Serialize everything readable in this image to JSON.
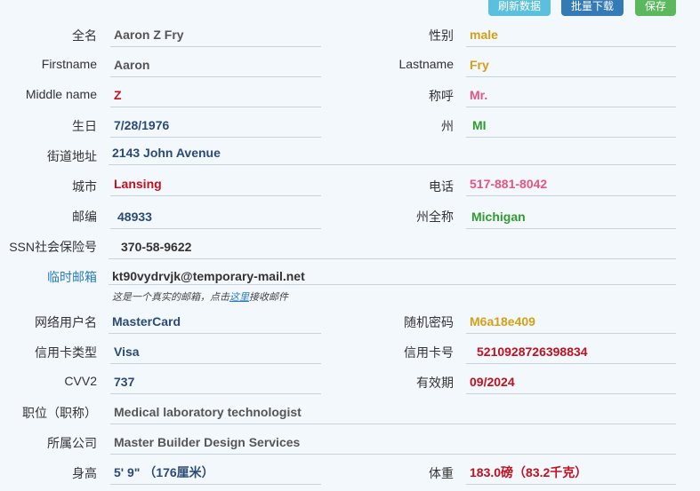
{
  "toolbar": {
    "refresh_label": "刷新数据",
    "batch_label": "批量下载",
    "save_label": "保存"
  },
  "fields": {
    "fullname": {
      "label": "全名",
      "value": "Aaron Z Fry"
    },
    "gender": {
      "label": "性别",
      "value": "male"
    },
    "firstname": {
      "label": "Firstname",
      "value": "Aaron"
    },
    "lastname": {
      "label": "Lastname",
      "value": "Fry"
    },
    "middlename": {
      "label": "Middle name",
      "value": "Z"
    },
    "title": {
      "label": "称呼",
      "value": "Mr."
    },
    "birthday": {
      "label": "生日",
      "value": "7/28/1976"
    },
    "state": {
      "label": "州",
      "value": "MI"
    },
    "street": {
      "label": "街道地址",
      "value": "2143 John Avenue"
    },
    "city": {
      "label": "城市",
      "value": "Lansing"
    },
    "phone": {
      "label": "电话",
      "value": "517-881-8042"
    },
    "zip": {
      "label": "邮编",
      "value": "48933"
    },
    "state_full": {
      "label": "州全称",
      "value": "Michigan"
    },
    "ssn": {
      "label": "SSN社会保险号",
      "value": "370-58-9622"
    },
    "temp_email": {
      "label": "临时邮箱",
      "value": "kt90vydrvjk@temporary-mail.net"
    },
    "username": {
      "label": "网络用户名",
      "value": "MasterCard"
    },
    "password": {
      "label": "随机密码",
      "value": "M6a18e409"
    },
    "card_type": {
      "label": "信用卡类型",
      "value": "Visa"
    },
    "card_number": {
      "label": "信用卡号",
      "value": "5210928726398834"
    },
    "cvv2": {
      "label": "CVV2",
      "value": "737"
    },
    "expiry": {
      "label": "有效期",
      "value": "09/2024"
    },
    "job": {
      "label": "职位（职称）",
      "value": "Medical laboratory technologist"
    },
    "company": {
      "label": "所属公司",
      "value": "Master Builder Design Services"
    },
    "height": {
      "label": "身高",
      "value": "5' 9\"  （176厘米）"
    },
    "weight": {
      "label": "体重",
      "value": "183.0磅（83.2千克）"
    }
  },
  "email_note": {
    "prefix": "这是一个真实的邮箱，点击",
    "link": "这里",
    "suffix": "接收邮件"
  }
}
